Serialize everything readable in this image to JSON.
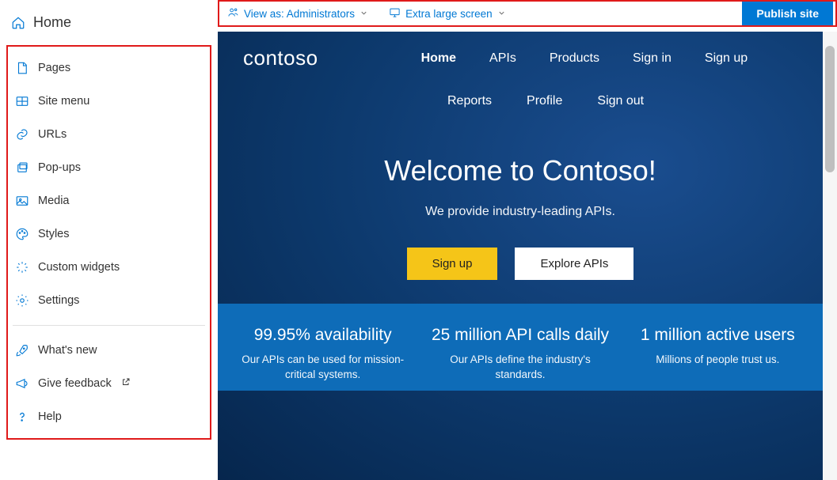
{
  "sidebar": {
    "title": "Home",
    "items": [
      {
        "label": "Pages",
        "icon": "page-icon"
      },
      {
        "label": "Site menu",
        "icon": "menu-icon"
      },
      {
        "label": "URLs",
        "icon": "link-icon"
      },
      {
        "label": "Pop-ups",
        "icon": "popup-icon"
      },
      {
        "label": "Media",
        "icon": "media-icon"
      },
      {
        "label": "Styles",
        "icon": "palette-icon"
      },
      {
        "label": "Custom widgets",
        "icon": "widget-icon"
      },
      {
        "label": "Settings",
        "icon": "gear-icon"
      }
    ],
    "footer": [
      {
        "label": "What's new",
        "icon": "rocket-icon"
      },
      {
        "label": "Give feedback",
        "icon": "megaphone-icon",
        "external": true
      },
      {
        "label": "Help",
        "icon": "help-icon"
      }
    ]
  },
  "topbar": {
    "viewas_label": "View as: Administrators",
    "screen_label": "Extra large screen",
    "publish_label": "Publish site"
  },
  "site": {
    "brand": "contoso",
    "nav": [
      "Home",
      "APIs",
      "Products",
      "Sign in",
      "Sign up"
    ],
    "nav2": [
      "Reports",
      "Profile",
      "Sign out"
    ],
    "hero_title": "Welcome to Contoso!",
    "hero_sub": "We provide industry-leading APIs.",
    "cta_primary": "Sign up",
    "cta_secondary": "Explore APIs",
    "stats": [
      {
        "title": "99.95% availability",
        "sub": "Our APIs can be used for mission-critical systems."
      },
      {
        "title": "25 million API calls daily",
        "sub": "Our APIs define the industry's standards."
      },
      {
        "title": "1 million active users",
        "sub": "Millions of people trust us."
      }
    ]
  }
}
